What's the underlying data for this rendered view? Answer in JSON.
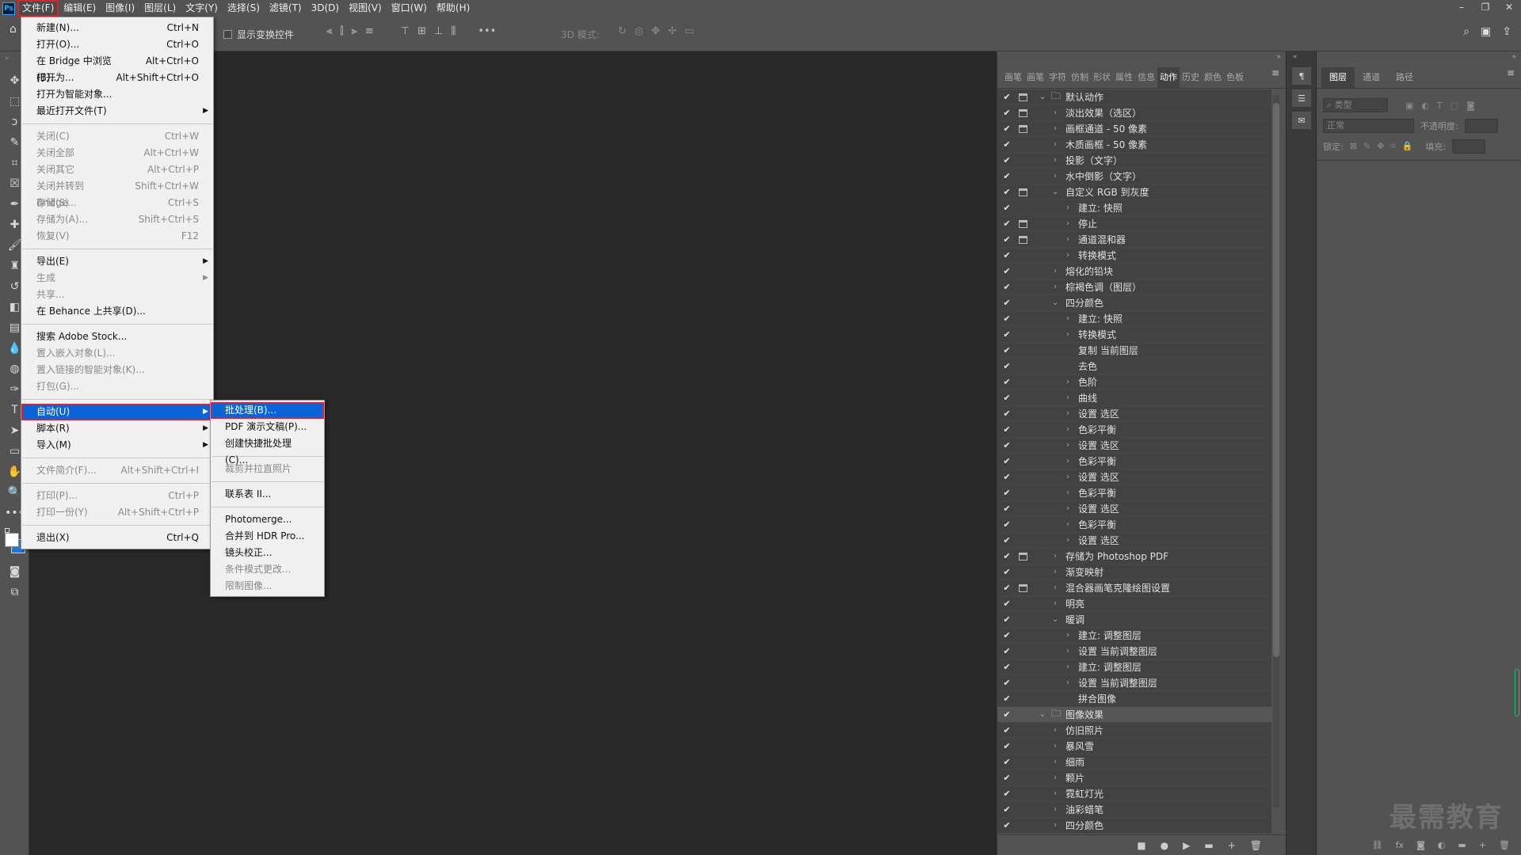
{
  "app": {
    "logo": "Ps"
  },
  "menubar": [
    "文件(F)",
    "编辑(E)",
    "图像(I)",
    "图层(L)",
    "文字(Y)",
    "选择(S)",
    "滤镜(T)",
    "3D(D)",
    "视图(V)",
    "窗口(W)",
    "帮助(H)"
  ],
  "window_controls": [
    "–",
    "❐",
    "✕"
  ],
  "options": {
    "show_transform": "显示变换控件",
    "mode_3d": "3D 模式:"
  },
  "file_menu": [
    {
      "label": "新建(N)...",
      "shortcut": "Ctrl+N"
    },
    {
      "label": "打开(O)...",
      "shortcut": "Ctrl+O"
    },
    {
      "label": "在 Bridge 中浏览(B)...",
      "shortcut": "Alt+Ctrl+O"
    },
    {
      "label": "打开为...",
      "shortcut": "Alt+Shift+Ctrl+O"
    },
    {
      "label": "打开为智能对象...",
      "shortcut": ""
    },
    {
      "label": "最近打开文件(T)",
      "shortcut": "",
      "submenu": true
    },
    {
      "sep": true
    },
    {
      "label": "关闭(C)",
      "shortcut": "Ctrl+W",
      "disabled": true
    },
    {
      "label": "关闭全部",
      "shortcut": "Alt+Ctrl+W",
      "disabled": true
    },
    {
      "label": "关闭其它",
      "shortcut": "Alt+Ctrl+P",
      "disabled": true
    },
    {
      "label": "关闭并转到 Bridge...",
      "shortcut": "Shift+Ctrl+W",
      "disabled": true
    },
    {
      "label": "存储(S)",
      "shortcut": "Ctrl+S",
      "disabled": true
    },
    {
      "label": "存储为(A)...",
      "shortcut": "Shift+Ctrl+S",
      "disabled": true
    },
    {
      "label": "恢复(V)",
      "shortcut": "F12",
      "disabled": true
    },
    {
      "sep": true
    },
    {
      "label": "导出(E)",
      "shortcut": "",
      "submenu": true
    },
    {
      "label": "生成",
      "shortcut": "",
      "submenu": true,
      "disabled": true
    },
    {
      "label": "共享...",
      "shortcut": "",
      "disabled": true
    },
    {
      "label": "在 Behance 上共享(D)...",
      "shortcut": ""
    },
    {
      "sep": true
    },
    {
      "label": "搜索 Adobe Stock...",
      "shortcut": ""
    },
    {
      "label": "置入嵌入对象(L)...",
      "shortcut": "",
      "disabled": true
    },
    {
      "label": "置入链接的智能对象(K)...",
      "shortcut": "",
      "disabled": true
    },
    {
      "label": "打包(G)...",
      "shortcut": "",
      "disabled": true
    },
    {
      "sep": true
    },
    {
      "label": "自动(U)",
      "shortcut": "",
      "submenu": true,
      "selected": true
    },
    {
      "label": "脚本(R)",
      "shortcut": "",
      "submenu": true
    },
    {
      "label": "导入(M)",
      "shortcut": "",
      "submenu": true
    },
    {
      "sep": true
    },
    {
      "label": "文件简介(F)...",
      "shortcut": "Alt+Shift+Ctrl+I",
      "disabled": true
    },
    {
      "sep": true
    },
    {
      "label": "打印(P)...",
      "shortcut": "Ctrl+P",
      "disabled": true
    },
    {
      "label": "打印一份(Y)",
      "shortcut": "Alt+Shift+Ctrl+P",
      "disabled": true
    },
    {
      "sep": true
    },
    {
      "label": "退出(X)",
      "shortcut": "Ctrl+Q"
    }
  ],
  "automate_menu": [
    {
      "label": "批处理(B)...",
      "selected": true
    },
    {
      "label": "PDF 演示文稿(P)..."
    },
    {
      "label": "创建快捷批处理(C)..."
    },
    {
      "sep": true
    },
    {
      "label": "裁剪并拉直照片",
      "disabled": true
    },
    {
      "sep": true
    },
    {
      "label": "联系表 II..."
    },
    {
      "sep": true
    },
    {
      "label": "Photomerge..."
    },
    {
      "label": "合并到 HDR Pro..."
    },
    {
      "label": "镜头校正..."
    },
    {
      "label": "条件模式更改...",
      "disabled": true
    },
    {
      "label": "限制图像...",
      "disabled": true
    }
  ],
  "panel_tabs": [
    "画笔",
    "画笔",
    "字符",
    "仿制",
    "形状",
    "属性",
    "信息",
    "动作",
    "历史",
    "颜色",
    "色板"
  ],
  "panel_active_tab": "动作",
  "actions": [
    {
      "label": "默认动作",
      "level": 0,
      "folder": true,
      "open": true,
      "dialog": true
    },
    {
      "label": "淡出效果（选区）",
      "level": 1,
      "dialog": true
    },
    {
      "label": "画框通道 - 50 像素",
      "level": 1,
      "dialog": true
    },
    {
      "label": "木质画框 - 50 像素",
      "level": 1
    },
    {
      "label": "投影（文字）",
      "level": 1
    },
    {
      "label": "水中倒影（文字）",
      "level": 1
    },
    {
      "label": "自定义 RGB 到灰度",
      "level": 1,
      "open": true,
      "dialog": true
    },
    {
      "label": "建立: 快照",
      "level": 2
    },
    {
      "label": "停止",
      "level": 2,
      "dialog": true
    },
    {
      "label": "通道混和器",
      "level": 2,
      "dialog": true
    },
    {
      "label": "转换模式",
      "level": 2
    },
    {
      "label": "熔化的铅块",
      "level": 1
    },
    {
      "label": "棕褐色调（图层）",
      "level": 1
    },
    {
      "label": "四分颜色",
      "level": 1,
      "open": true
    },
    {
      "label": "建立: 快照",
      "level": 2
    },
    {
      "label": "转换模式",
      "level": 2
    },
    {
      "label": "复制 当前图层",
      "level": 2,
      "noarrow": true
    },
    {
      "label": "去色",
      "level": 2,
      "noarrow": true
    },
    {
      "label": "色阶",
      "level": 2
    },
    {
      "label": "曲线",
      "level": 2
    },
    {
      "label": "设置 选区",
      "level": 2
    },
    {
      "label": "色彩平衡",
      "level": 2
    },
    {
      "label": "设置 选区",
      "level": 2
    },
    {
      "label": "色彩平衡",
      "level": 2
    },
    {
      "label": "设置 选区",
      "level": 2
    },
    {
      "label": "色彩平衡",
      "level": 2
    },
    {
      "label": "设置 选区",
      "level": 2
    },
    {
      "label": "色彩平衡",
      "level": 2
    },
    {
      "label": "设置 选区",
      "level": 2
    },
    {
      "label": "存储为 Photoshop PDF",
      "level": 1,
      "dialog": true
    },
    {
      "label": "渐变映射",
      "level": 1
    },
    {
      "label": "混合器画笔克隆绘图设置",
      "level": 1,
      "dialog": true
    },
    {
      "label": "明亮",
      "level": 1
    },
    {
      "label": "暖调",
      "level": 1,
      "open": true
    },
    {
      "label": "建立: 调整图层",
      "level": 2
    },
    {
      "label": "设置 当前调整图层",
      "level": 2
    },
    {
      "label": "建立: 调整图层",
      "level": 2
    },
    {
      "label": "设置 当前调整图层",
      "level": 2
    },
    {
      "label": "拼合图像",
      "level": 2,
      "noarrow": true
    },
    {
      "label": "图像效果",
      "level": 0,
      "folder": true,
      "open": true,
      "highlight": true
    },
    {
      "label": "仿旧照片",
      "level": 1
    },
    {
      "label": "暴风雪",
      "level": 1
    },
    {
      "label": "细雨",
      "level": 1
    },
    {
      "label": "颗片",
      "level": 1
    },
    {
      "label": "霓虹灯光",
      "level": 1
    },
    {
      "label": "油彩蜡笔",
      "level": 1
    },
    {
      "label": "四分颜色",
      "level": 1
    }
  ],
  "actions_bottom": [
    "■",
    "●",
    "▶",
    "▬",
    "+",
    "🗑"
  ],
  "layers": {
    "tabs": [
      "图层",
      "通道",
      "路径"
    ],
    "active_tab": "图层",
    "filter_placeholder": "类型",
    "blend_mode": "正常",
    "opacity_label": "不透明度:",
    "lock_label": "锁定:",
    "fill_label": "填充:"
  },
  "watermark": "最需教育"
}
